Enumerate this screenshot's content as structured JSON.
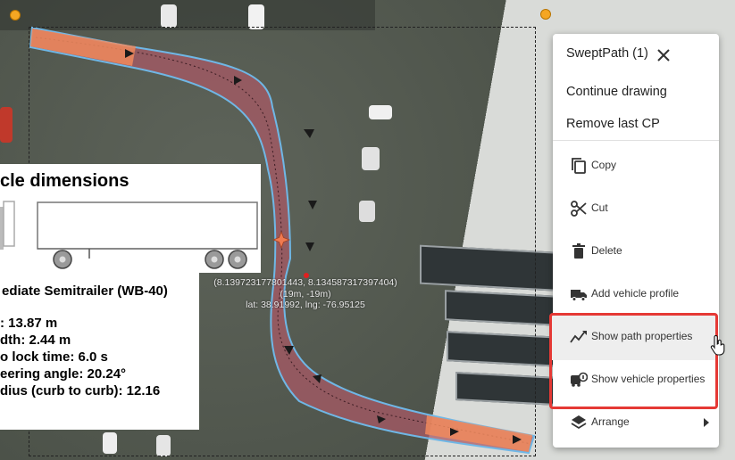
{
  "menu": {
    "header": "SweptPath (1)",
    "continue_drawing": "Continue drawing",
    "remove_last_cp": "Remove last CP",
    "items": [
      {
        "label": "Copy",
        "icon": "copy-icon"
      },
      {
        "label": "Cut",
        "icon": "scissors-icon"
      },
      {
        "label": "Delete",
        "icon": "trash-icon"
      },
      {
        "label": "Add vehicle profile",
        "icon": "truck-icon"
      },
      {
        "label": "Show path properties",
        "icon": "path-chart-icon"
      },
      {
        "label": "Show vehicle properties",
        "icon": "vehicle-info-icon"
      },
      {
        "label": "Arrange",
        "icon": "layers-icon"
      }
    ]
  },
  "coordinates": {
    "line1": "(8.139723177801443, 8.134587317397404)",
    "line2": "(19m, -19m)",
    "line3": "lat: 38.91992, lng: -76.95125"
  },
  "vehicle_info": {
    "dimensions_title": "cle dimensions",
    "name": "ediate Semitrailer (WB-40)",
    "specs": [
      ": 13.87 m",
      "dth: 2.44 m",
      "o lock time: 6.0 s",
      "eering angle: 20.24°",
      "dius (curb to curb): 12.16"
    ]
  },
  "colors": {
    "path_fill": "#a85a66",
    "path_outline": "#6fb7e6",
    "vehicle_box": "#f08a5d",
    "handle": "#f5a623",
    "highlight": "#e53935"
  }
}
